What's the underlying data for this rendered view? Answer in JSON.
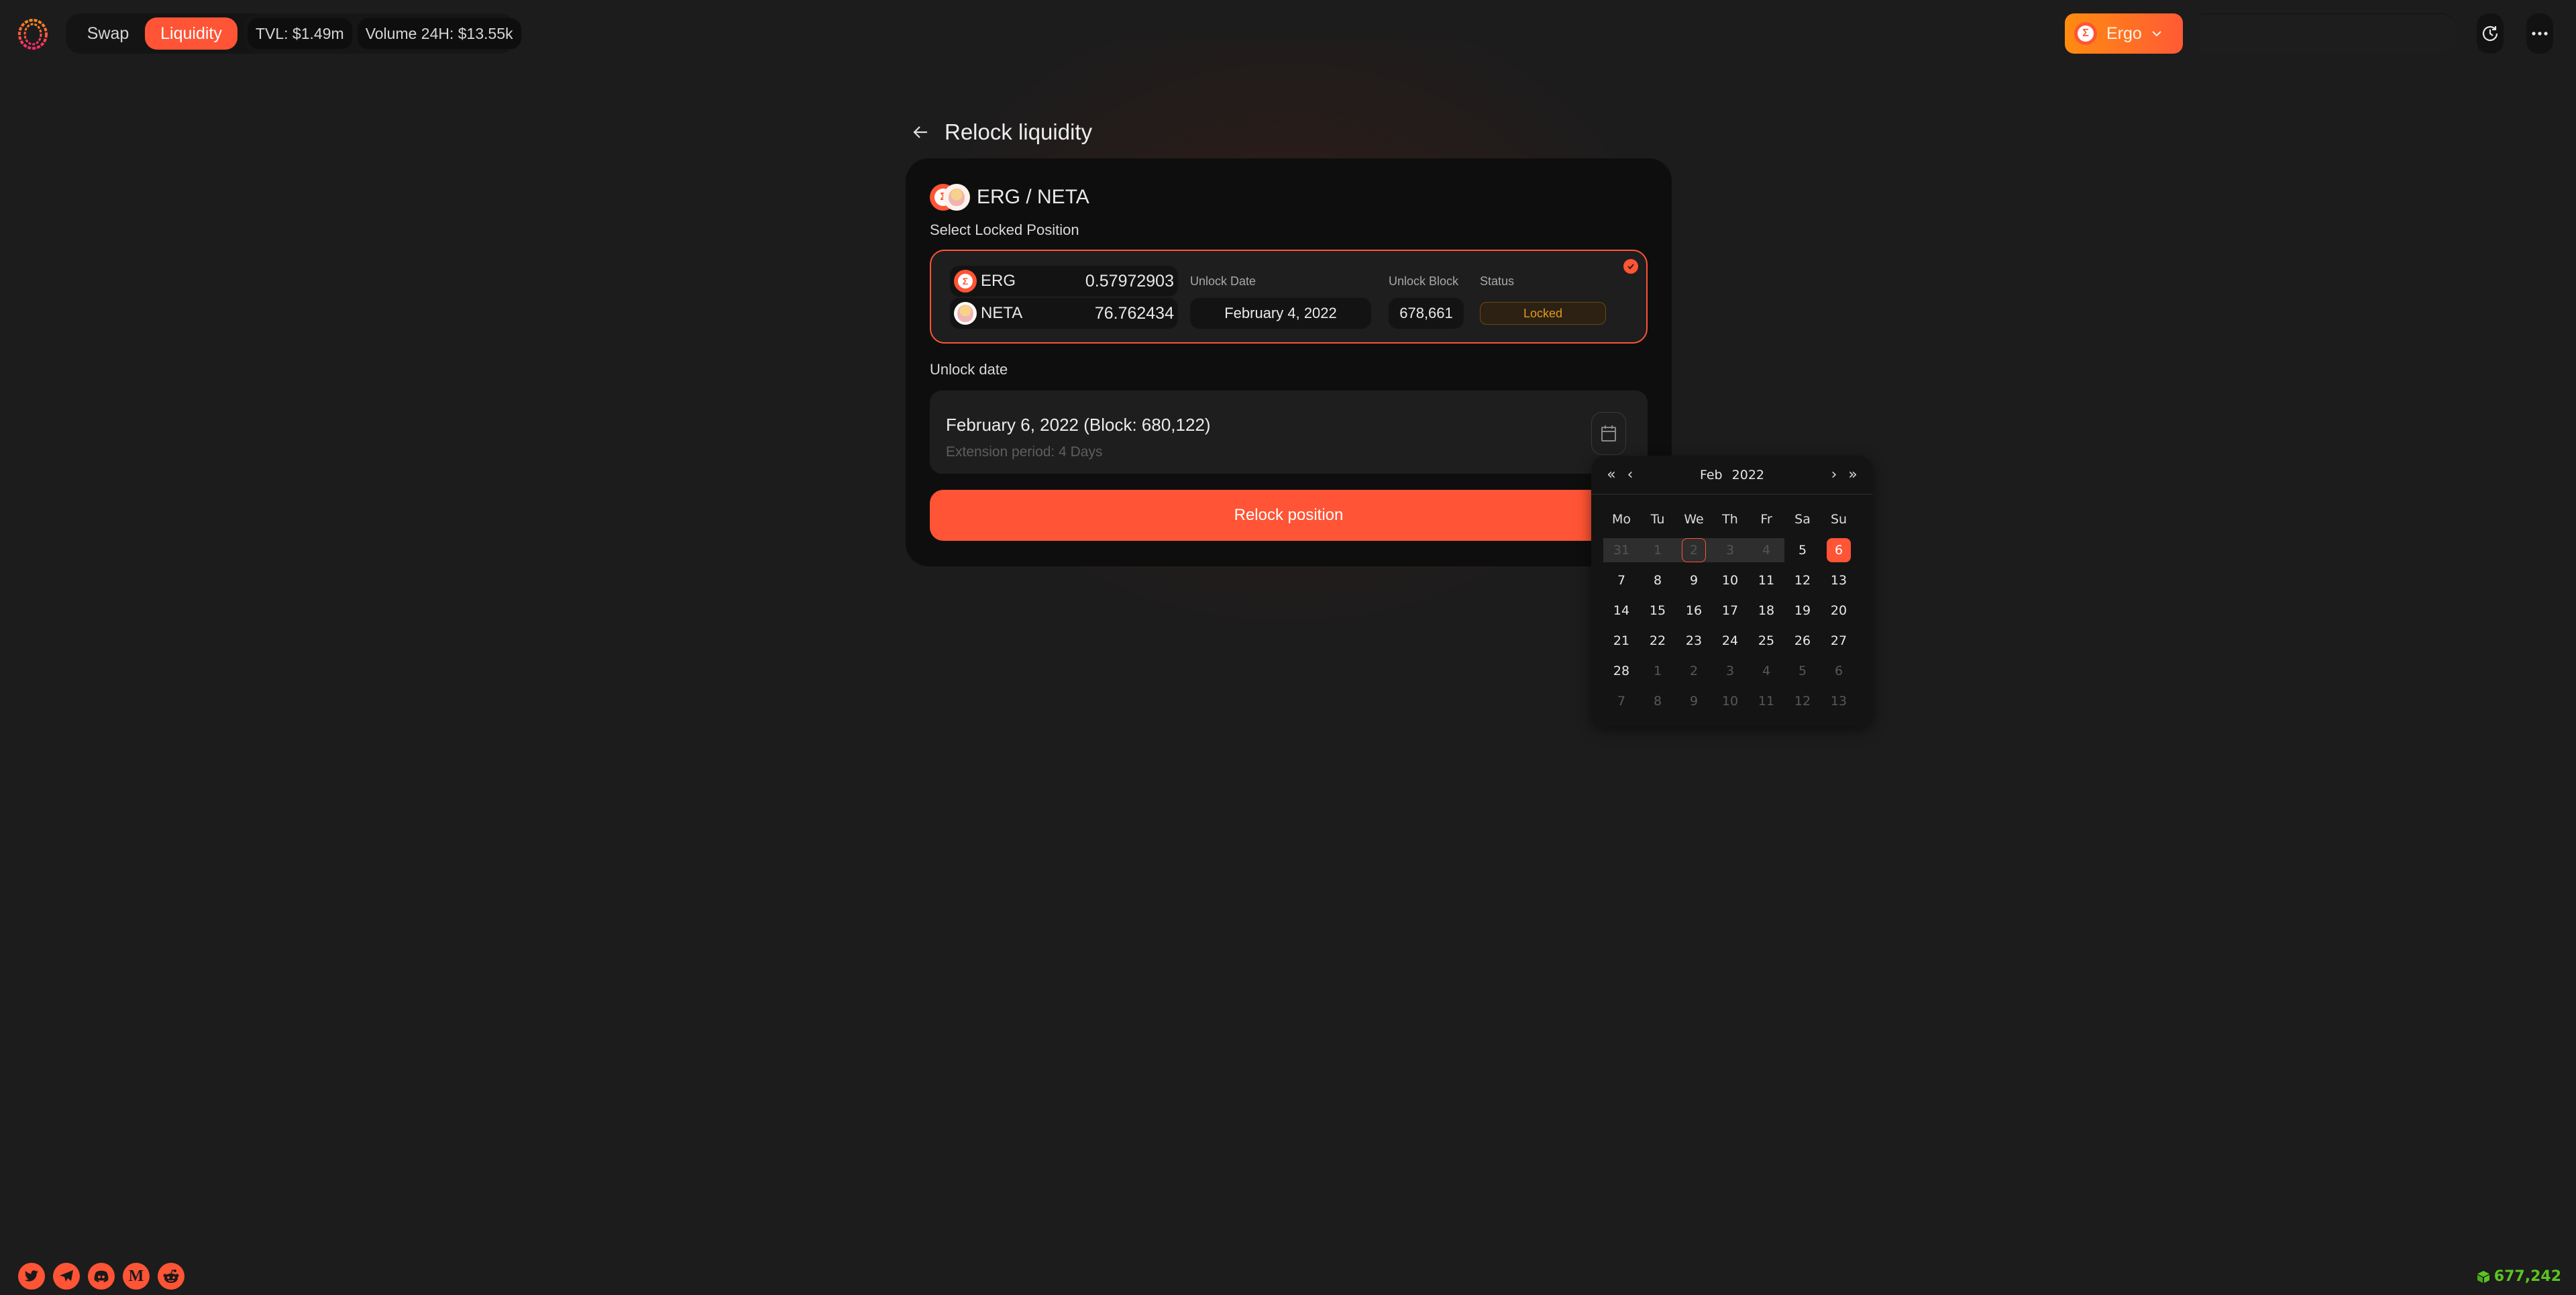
{
  "header": {
    "nav": [
      {
        "label": "Swap",
        "active": false
      },
      {
        "label": "Liquidity",
        "active": true
      }
    ],
    "stats": {
      "tvl": "TVL: $1.49m",
      "volume": "Volume 24H: $13.55k"
    },
    "network": {
      "label": "Ergo",
      "icon": "erg-coin-icon"
    },
    "icons": [
      "history-icon",
      "more-icon"
    ]
  },
  "page": {
    "title": "Relock liquidity",
    "back_icon": "arrow-left-icon"
  },
  "card": {
    "pair_name": "ERG / NETA",
    "select_label": "Select Locked Position",
    "position": {
      "assets": [
        {
          "symbol": "ERG",
          "amount": "0.57972903"
        },
        {
          "symbol": "NETA",
          "amount": "76.762434"
        }
      ],
      "unlock_date_label": "Unlock Date",
      "unlock_date": "February 4, 2022",
      "unlock_block_label": "Unlock Block",
      "unlock_block": "678,661",
      "status_label": "Status",
      "status": "Locked",
      "selected": true
    },
    "unlock_date_label": "Unlock date",
    "new_unlock": "February 6, 2022 (Block: 680,122)",
    "extension": "Extension period: 4 Days",
    "relock_button": "Relock position"
  },
  "calendar": {
    "month": "Feb",
    "year": "2022",
    "weekdays": [
      "Mo",
      "Tu",
      "We",
      "Th",
      "Fr",
      "Sa",
      "Su"
    ],
    "weeks": [
      [
        {
          "d": "31",
          "s": "disabled"
        },
        {
          "d": "1",
          "s": "disabled"
        },
        {
          "d": "2",
          "s": "disabled-today"
        },
        {
          "d": "3",
          "s": "disabled"
        },
        {
          "d": "4",
          "s": "disabled"
        },
        {
          "d": "5",
          "s": ""
        },
        {
          "d": "6",
          "s": "selected"
        }
      ],
      [
        {
          "d": "7",
          "s": ""
        },
        {
          "d": "8",
          "s": ""
        },
        {
          "d": "9",
          "s": ""
        },
        {
          "d": "10",
          "s": ""
        },
        {
          "d": "11",
          "s": ""
        },
        {
          "d": "12",
          "s": ""
        },
        {
          "d": "13",
          "s": ""
        }
      ],
      [
        {
          "d": "14",
          "s": ""
        },
        {
          "d": "15",
          "s": ""
        },
        {
          "d": "16",
          "s": ""
        },
        {
          "d": "17",
          "s": ""
        },
        {
          "d": "18",
          "s": ""
        },
        {
          "d": "19",
          "s": ""
        },
        {
          "d": "20",
          "s": ""
        }
      ],
      [
        {
          "d": "21",
          "s": ""
        },
        {
          "d": "22",
          "s": ""
        },
        {
          "d": "23",
          "s": ""
        },
        {
          "d": "24",
          "s": ""
        },
        {
          "d": "25",
          "s": ""
        },
        {
          "d": "26",
          "s": ""
        },
        {
          "d": "27",
          "s": ""
        }
      ],
      [
        {
          "d": "28",
          "s": ""
        },
        {
          "d": "1",
          "s": "muted"
        },
        {
          "d": "2",
          "s": "muted"
        },
        {
          "d": "3",
          "s": "muted"
        },
        {
          "d": "4",
          "s": "muted"
        },
        {
          "d": "5",
          "s": "muted"
        },
        {
          "d": "6",
          "s": "muted"
        }
      ],
      [
        {
          "d": "7",
          "s": "muted"
        },
        {
          "d": "8",
          "s": "muted"
        },
        {
          "d": "9",
          "s": "muted"
        },
        {
          "d": "10",
          "s": "muted"
        },
        {
          "d": "11",
          "s": "muted"
        },
        {
          "d": "12",
          "s": "muted"
        },
        {
          "d": "13",
          "s": "muted"
        }
      ]
    ]
  },
  "footer": {
    "socials": [
      "twitter-icon",
      "telegram-icon",
      "discord-icon",
      "medium-icon",
      "reddit-icon"
    ],
    "block_height": "677,242"
  },
  "colors": {
    "accent": "#ff5435",
    "network_gradient_start": "#ff8c10",
    "status_locked": "#e39a1b",
    "block_height": "#5cc420",
    "background": "#1c1c1c",
    "card": "#0e0e0e"
  }
}
